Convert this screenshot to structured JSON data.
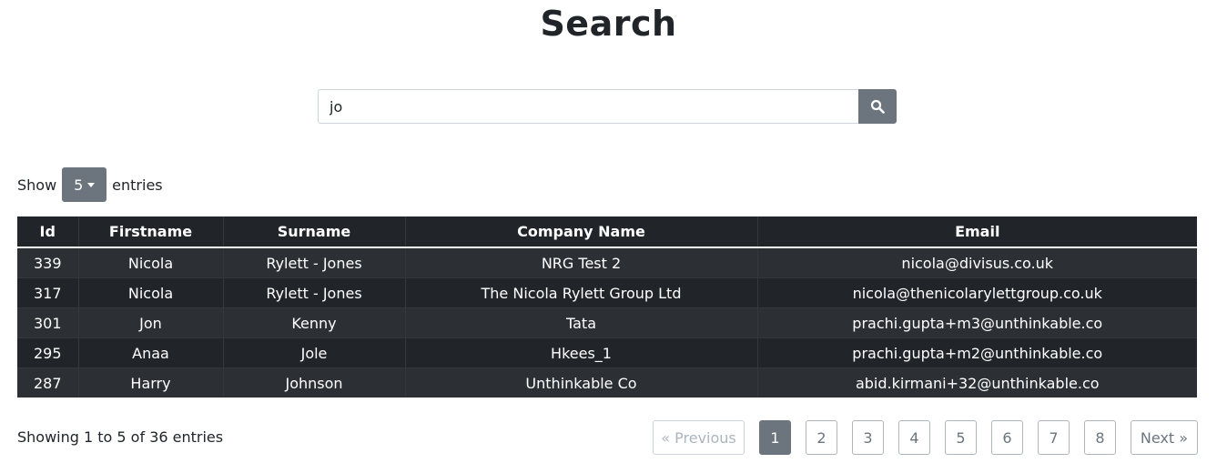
{
  "header": {
    "title": "Search"
  },
  "search": {
    "value": "jo",
    "placeholder": ""
  },
  "length_control": {
    "show_label": "Show",
    "selected": "5",
    "entries_label": "entries"
  },
  "table": {
    "columns": [
      "Id",
      "Firstname",
      "Surname",
      "Company Name",
      "Email"
    ],
    "rows": [
      [
        "339",
        "Nicola",
        "Rylett - Jones",
        "NRG Test 2",
        "nicola@divisus.co.uk"
      ],
      [
        "317",
        "Nicola",
        "Rylett - Jones",
        "The Nicola Rylett Group Ltd",
        "nicola@thenicolarylettgroup.co.uk"
      ],
      [
        "301",
        "Jon",
        "Kenny",
        "Tata",
        "prachi.gupta+m3@unthinkable.co"
      ],
      [
        "295",
        "Anaa",
        "Jole",
        "Hkees_1",
        "prachi.gupta+m2@unthinkable.co"
      ],
      [
        "287",
        "Harry",
        "Johnson",
        "Unthinkable Co",
        "abid.kirmani+32@unthinkable.co"
      ]
    ]
  },
  "footer": {
    "info": "Showing 1 to 5 of 36 entries"
  },
  "pagination": {
    "previous": "« Previous",
    "pages": [
      "1",
      "2",
      "3",
      "4",
      "5",
      "6",
      "7",
      "8"
    ],
    "active": "1",
    "next": "Next »"
  }
}
